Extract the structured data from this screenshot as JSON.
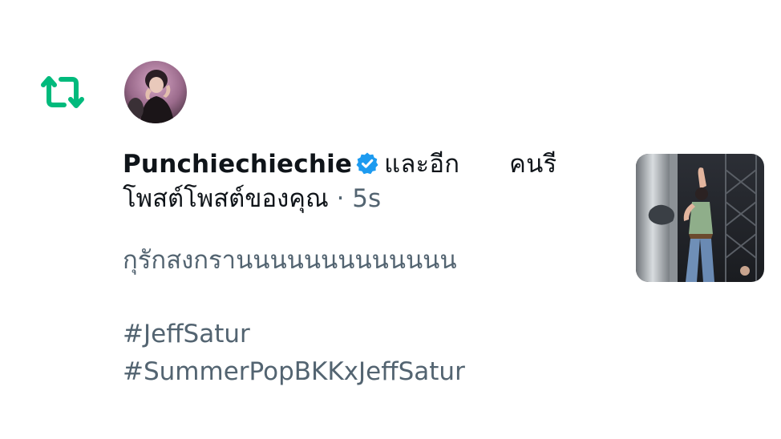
{
  "notification": {
    "type_icon": "retweet-icon",
    "user_name": "Punchiechiechie",
    "verified_icon": "verified-badge-icon",
    "and_others_text": "และอีก",
    "others_suffix": "คนรี",
    "action_line": "โพสต์โพสต์ของคุณ",
    "separator": "·",
    "timestamp": "5s",
    "tweet_text": "กุรักสงกรานนนนนนนนนนนนน",
    "hashtags": [
      "#JeffSatur",
      "#SummerPopBKKxJeffSatur"
    ]
  },
  "colors": {
    "retweet_green": "#00BA7C",
    "verified_blue": "#1D9BF0",
    "secondary_text": "#536471",
    "primary_text": "#0F1419"
  }
}
